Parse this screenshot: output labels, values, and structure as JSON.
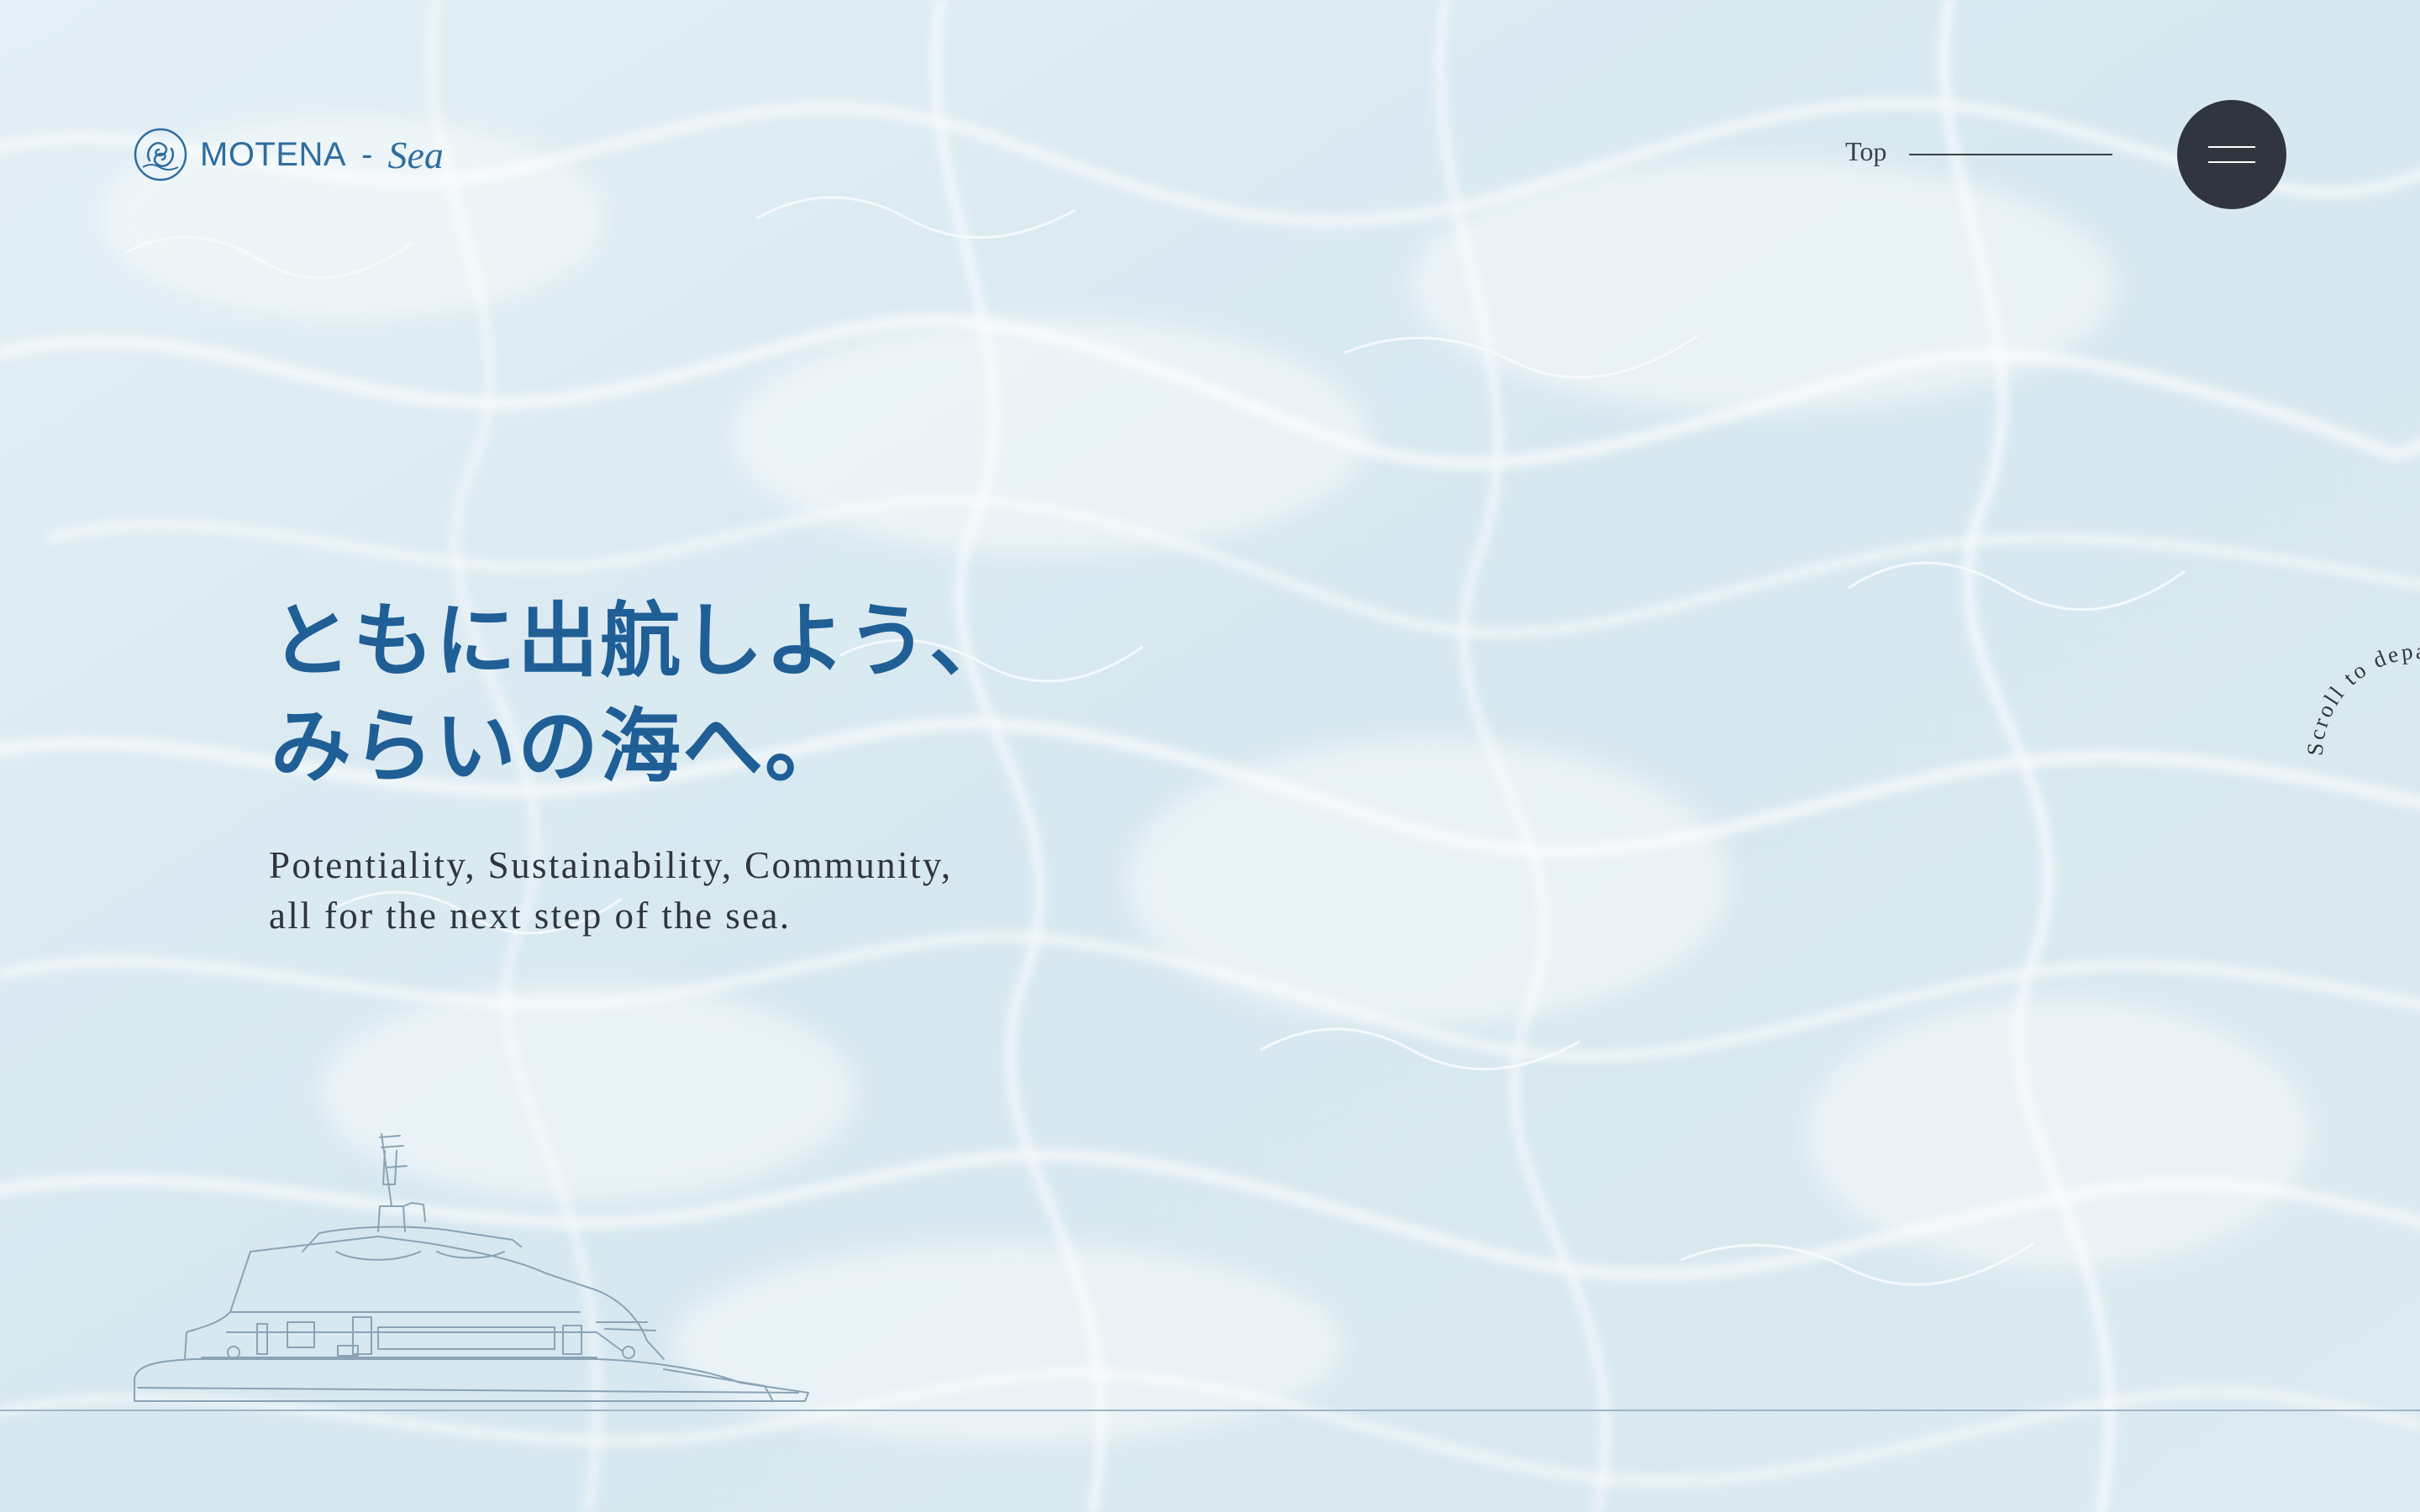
{
  "header": {
    "logo": {
      "text": "MOTENA",
      "dash": "-",
      "script": "Sea",
      "icon": "seahorse-emblem-icon"
    },
    "nav_link": "Top",
    "menu_icon": "hamburger-icon"
  },
  "hero": {
    "title_lines": [
      "ともに出航しよう、",
      "みらいの海へ。"
    ],
    "subtitle_lines": [
      "Potentiality, Sustainability, Community,",
      "all for the next step of the sea."
    ]
  },
  "scroll_prompt": {
    "text": "Scroll to depart Scroll to depart "
  },
  "illustration": {
    "subject": "ship-outline-icon"
  },
  "colors": {
    "accent": "#1f5f96",
    "logo": "#2f6d9e",
    "dark": "#30353f",
    "water": "#dbeaf1"
  }
}
